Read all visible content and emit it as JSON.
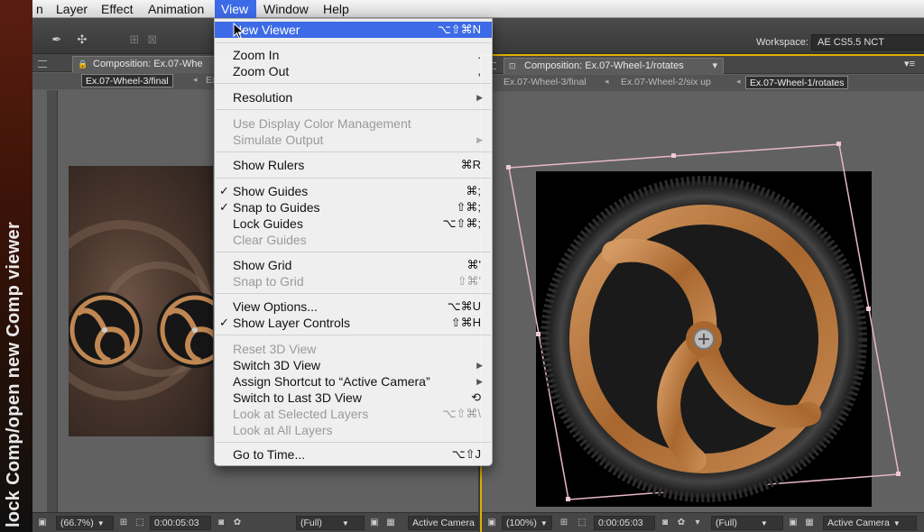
{
  "side_caption": "lock Comp/open new Comp viewer",
  "menubar": {
    "items": [
      {
        "label": "n"
      },
      {
        "label": "Layer"
      },
      {
        "label": "Effect"
      },
      {
        "label": "Animation"
      },
      {
        "label": "View"
      },
      {
        "label": "Window"
      },
      {
        "label": "Help"
      }
    ]
  },
  "toolbar": {
    "workspace_label": "Workspace:",
    "workspace_value": "AE CS5.5 NCT"
  },
  "left_panel": {
    "tab_title": "Composition: Ex.07-Whe",
    "crumbs": [
      "Ex.07-Wheel-3/final",
      "Ex"
    ],
    "bottom": {
      "zoom": "(66.7%)",
      "timecode": "0:00:05:03",
      "resolution": "(Full)",
      "camera": "Active Camera"
    }
  },
  "right_panel": {
    "tab_title": "Composition: Ex.07-Wheel-1/rotates",
    "crumbs": [
      "Ex.07-Wheel-3/final",
      "Ex.07-Wheel-2/six up",
      "Ex.07-Wheel-1/rotates"
    ],
    "bottom": {
      "zoom": "(100%)",
      "timecode": "0:00:05:03",
      "resolution": "(Full)",
      "camera": "Active Camera"
    }
  },
  "view_menu": {
    "items": [
      {
        "label": "New Viewer",
        "shortcut": "⌥⇧⌘N"
      },
      {
        "label": "Zoom In",
        "shortcut": "."
      },
      {
        "label": "Zoom Out",
        "shortcut": ","
      },
      {
        "label": "Resolution"
      },
      {
        "label": "Use Display Color Management"
      },
      {
        "label": "Simulate Output"
      },
      {
        "label": "Show Rulers",
        "shortcut": "⌘R"
      },
      {
        "label": "Show Guides",
        "shortcut": "⌘;"
      },
      {
        "label": "Snap to Guides",
        "shortcut": "⇧⌘;"
      },
      {
        "label": "Lock Guides",
        "shortcut": "⌥⇧⌘;"
      },
      {
        "label": "Clear Guides"
      },
      {
        "label": "Show Grid",
        "shortcut": "⌘'"
      },
      {
        "label": "Snap to Grid",
        "shortcut": "⇧⌘'"
      },
      {
        "label": "View Options...",
        "shortcut": "⌥⌘U"
      },
      {
        "label": "Show Layer Controls",
        "shortcut": "⇧⌘H"
      },
      {
        "label": "Reset 3D View"
      },
      {
        "label": "Switch 3D View"
      },
      {
        "label": "Assign Shortcut to “Active Camera”"
      },
      {
        "label": "Switch to Last 3D View",
        "shortcut": "⟲"
      },
      {
        "label": "Look at Selected Layers",
        "shortcut": "⌥⇧⌘\\"
      },
      {
        "label": "Look at All Layers"
      },
      {
        "label": "Go to Time...",
        "shortcut": "⌥⇧J"
      }
    ]
  },
  "colors": {
    "menu_highlight": "#3d6ae6",
    "active_panel_border": "#e0b000",
    "wheel_wood": "#b87a46"
  }
}
